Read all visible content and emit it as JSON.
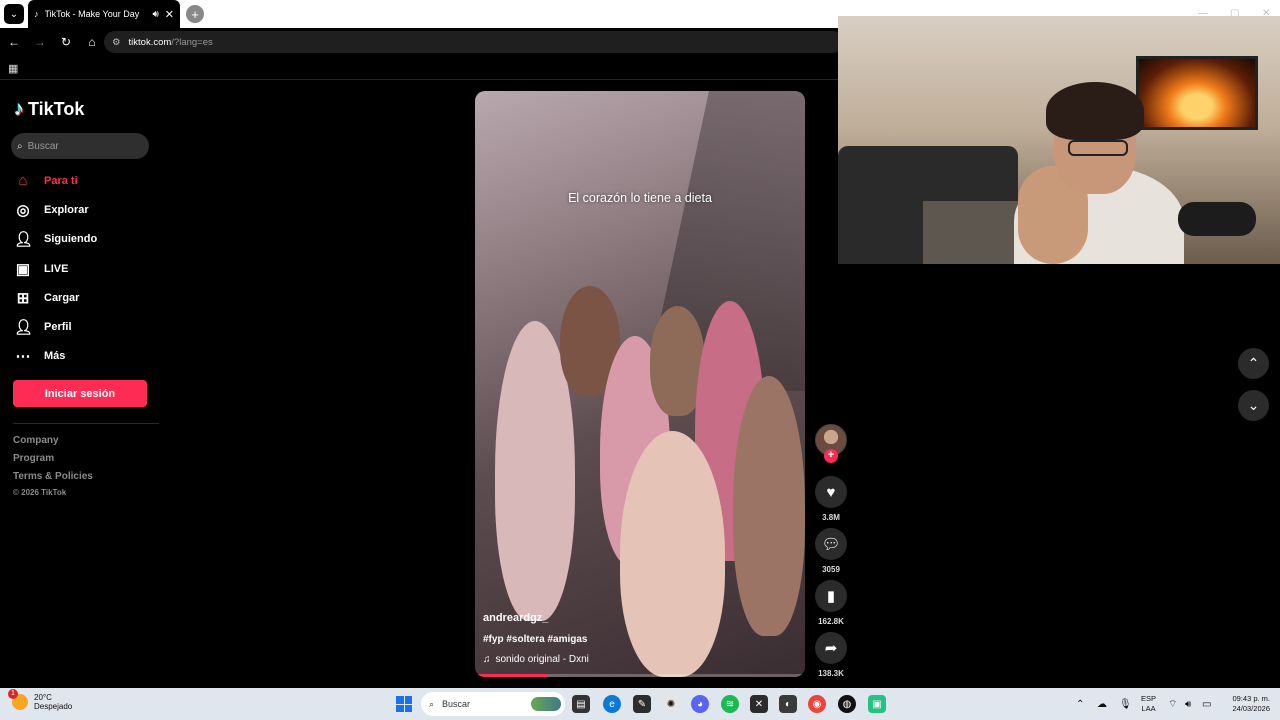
{
  "browser": {
    "tab_title": "TikTok - Make Your Day",
    "url_host": "tiktok.com",
    "url_path": "/?lang=es"
  },
  "sidebar": {
    "logo_text": "TikTok",
    "search_placeholder": "Buscar",
    "items": [
      {
        "label": "Para ti",
        "icon": "home-icon",
        "active": true
      },
      {
        "label": "Explorar",
        "icon": "compass-icon"
      },
      {
        "label": "Siguiendo",
        "icon": "user-follow-icon"
      },
      {
        "label": "LIVE",
        "icon": "live-tv-icon"
      },
      {
        "label": "Cargar",
        "icon": "upload-icon"
      },
      {
        "label": "Perfil",
        "icon": "person-icon"
      },
      {
        "label": "Más",
        "icon": "more-icon"
      }
    ],
    "login_label": "Iniciar sesión",
    "footer_links": [
      "Company",
      "Program",
      "Terms & Policies"
    ],
    "copyright": "© 2026 TikTok"
  },
  "video": {
    "overlay_caption": "El corazón lo tiene a dieta",
    "username": "andreardgz_",
    "hashtags": "#fyp #soltera #amigas",
    "sound": "sonido original - Dxni",
    "progress": 0.22
  },
  "actions": {
    "likes": "3.8M",
    "comments": "3059",
    "saves": "162.8K",
    "shares": "138.3K"
  },
  "taskbar": {
    "temperature": "20°C",
    "weather": "Despejado",
    "weather_badge": "1",
    "search_placeholder": "Buscar",
    "lang_line1": "ESP",
    "lang_line2": "LAA",
    "time": "09:43 p. m.",
    "date": "24/03/2026"
  },
  "colors": {
    "accent": "#fe2c55",
    "taskbar_bg": "#dfe6ee"
  }
}
